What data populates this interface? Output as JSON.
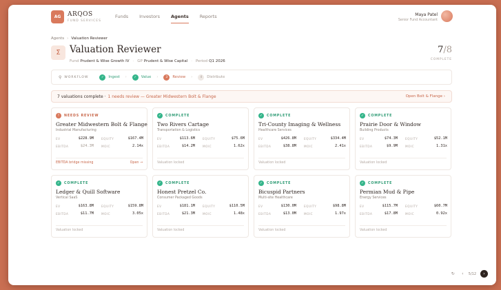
{
  "brand": {
    "initials": "AG",
    "name": "ARQOS",
    "sub": "FUND SERVICES"
  },
  "nav": [
    {
      "label": "Funds",
      "active": false
    },
    {
      "label": "Investors",
      "active": false
    },
    {
      "label": "Agents",
      "active": true
    },
    {
      "label": "Reports",
      "active": false
    }
  ],
  "user": {
    "name": "Maya Patel",
    "role": "Senior Fund Accountant"
  },
  "breadcrumb": {
    "parent": "Agents",
    "sep": "›",
    "current": "Valuation Reviewer"
  },
  "page": {
    "icon": "Σ",
    "title": "Valuation Reviewer",
    "fund_label": "Fund",
    "fund_value": "Prudent & Wise Growth IV",
    "gp_label": "GP",
    "gp_value": "Prudent & Wise Capital",
    "period_label": "Period",
    "period_value": "Q1 2026",
    "count_done": "7",
    "count_total": "/8",
    "count_label": "COMPLETE"
  },
  "workflow": {
    "label": "WORKFLOW",
    "steps": [
      {
        "num": "✓",
        "label": "Ingest",
        "state": "done"
      },
      {
        "num": "✓",
        "label": "Value",
        "state": "done"
      },
      {
        "num": "3",
        "label": "Review",
        "state": "cur"
      },
      {
        "num": "4",
        "label": "Distribute",
        "state": "todo"
      }
    ],
    "sep": "›"
  },
  "summary": {
    "main": "7 valuations complete ·",
    "flag": "1 needs review — Greater Midwestern Bolt & Flange",
    "open": "Open Bolt & Flange ›"
  },
  "labels": {
    "ev": "EV",
    "equity": "EQUITY",
    "ebitda": "EBITDA",
    "moic": "MOIC"
  },
  "cards": [
    {
      "status": "NEEDS REVIEW",
      "state": "warn",
      "icon": "!",
      "name": "Greater Midwestern Bolt & Flange",
      "sector": "Industrial Manufacturing",
      "ev": "$228.9M",
      "equity": "$167.4M",
      "ebitda": "$24.3M",
      "moic": "2.14x",
      "foot": "EBITDA bridge missing",
      "open": "Open →"
    },
    {
      "status": "COMPLETE",
      "state": "ok",
      "icon": "✓",
      "name": "Two Rivers Cartage",
      "sector": "Transportation & Logistics",
      "ev": "$113.6M",
      "equity": "$75.6M",
      "ebitda": "$14.2M",
      "moic": "1.62x",
      "foot": "Valuation locked",
      "open": ""
    },
    {
      "status": "COMPLETE",
      "state": "ok",
      "icon": "✓",
      "name": "Tri-County Imaging & Wellness",
      "sector": "Healthcare Services",
      "ev": "$426.8M",
      "equity": "$334.4M",
      "ebitda": "$38.8M",
      "moic": "2.41x",
      "foot": "Valuation locked",
      "open": ""
    },
    {
      "status": "COMPLETE",
      "state": "ok",
      "icon": "✓",
      "name": "Prairie Door & Window",
      "sector": "Building Products",
      "ev": "$74.3M",
      "equity": "$52.1M",
      "ebitda": "$9.9M",
      "moic": "1.31x",
      "foot": "Valuation locked",
      "open": ""
    },
    {
      "status": "COMPLETE",
      "state": "ok",
      "icon": "✓",
      "name": "Ledger & Quill Software",
      "sector": "Vertical SaaS",
      "ev": "$163.8M",
      "equity": "$159.8M",
      "ebitda": "$11.7M",
      "moic": "3.05x",
      "foot": "Valuation locked",
      "open": ""
    },
    {
      "status": "COMPLETE",
      "state": "ok",
      "icon": "✓",
      "name": "Honest Pretzel Co.",
      "sector": "Consumer Packaged Goods",
      "ev": "$181.1M",
      "equity": "$110.5M",
      "ebitda": "$21.3M",
      "moic": "1.48x",
      "foot": "Valuation locked",
      "open": ""
    },
    {
      "status": "COMPLETE",
      "state": "ok",
      "icon": "✓",
      "name": "Bicuspid Partners",
      "sector": "Multi-site Healthcare",
      "ev": "$130.0M",
      "equity": "$98.8M",
      "ebitda": "$13.0M",
      "moic": "1.97x",
      "foot": "Valuation locked",
      "open": ""
    },
    {
      "status": "COMPLETE",
      "state": "ok",
      "icon": "✓",
      "name": "Permian Mud & Pipe",
      "sector": "Energy Services",
      "ev": "$115.7M",
      "equity": "$60.7M",
      "ebitda": "$17.8M",
      "moic": "0.92x",
      "foot": "Valuation locked",
      "open": ""
    }
  ],
  "pager": {
    "refresh": "↻",
    "prev": "‹",
    "text": "5/12",
    "next": "›"
  }
}
